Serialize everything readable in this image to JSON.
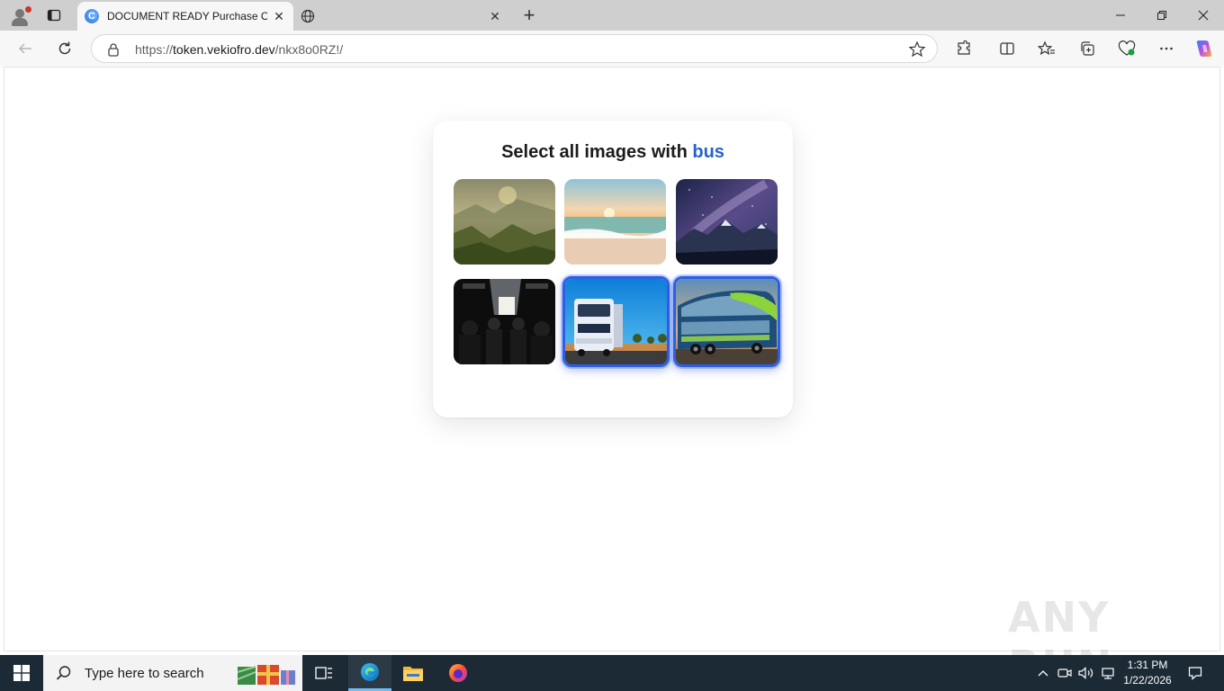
{
  "browser": {
    "tabs": [
      {
        "title": "DOCUMENT READY Purchase Orc",
        "favicon": "edge-c-icon",
        "active": true
      },
      {
        "title": "",
        "favicon": "globe-icon",
        "active": false
      }
    ],
    "address": {
      "scheme": "https://",
      "host": "token.vekiofro.dev",
      "path": "/nkx8o0RZ!/"
    }
  },
  "captcha": {
    "prompt": "Select all images with",
    "keyword": "bus",
    "tiles": [
      {
        "scene": "mountain valley at sunrise",
        "selected": false
      },
      {
        "scene": "beach at sunset",
        "selected": false
      },
      {
        "scene": "milky way over mountains",
        "selected": false
      },
      {
        "scene": "bus interior with passengers",
        "selected": false
      },
      {
        "scene": "truck on road",
        "selected": true
      },
      {
        "scene": "double-decker bus",
        "selected": true
      }
    ],
    "selected_color": "#2f5ee6",
    "keyword_color": "#2563c9"
  },
  "watermark": "ANY RUN",
  "taskbar": {
    "search_placeholder": "Type here to search",
    "time": "1:31 PM",
    "date": "1/22/2026"
  }
}
